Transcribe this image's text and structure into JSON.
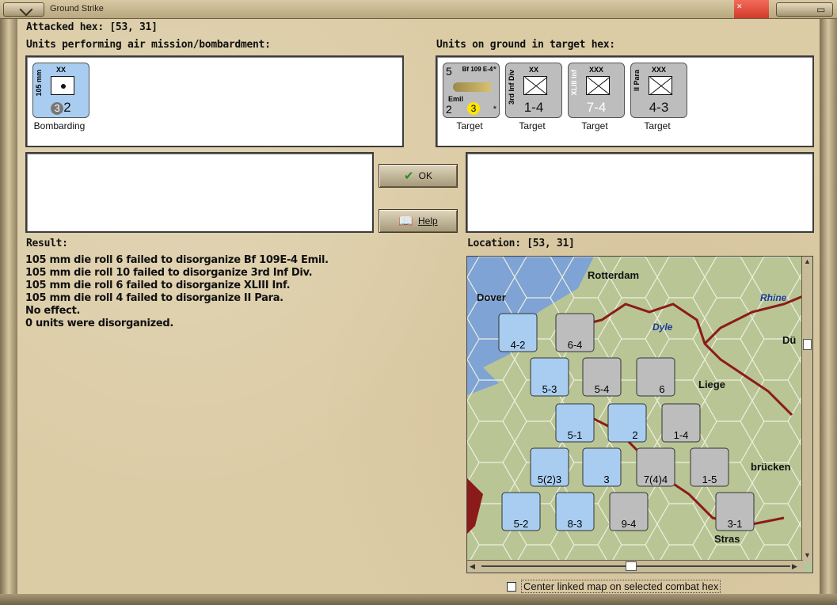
{
  "window": {
    "title": "Ground Strike"
  },
  "attacked_hex": {
    "label": "Attacked hex:",
    "value": "[53, 31]"
  },
  "air_units": {
    "label": "Units performing air mission/bombardment:",
    "items": [
      {
        "top": "XX",
        "side": "105 mm",
        "badge": "3",
        "value": "2",
        "caption": "Bombarding"
      }
    ]
  },
  "ground_units": {
    "label": "Units on ground in target hex:",
    "items": [
      {
        "top": "Bf 109 E-4",
        "side": "",
        "name": "Emil",
        "value": "",
        "strength_left": "5",
        "strength_bottom": "2",
        "badge": "3",
        "caption": "Target",
        "kind": "air"
      },
      {
        "top": "XX",
        "side": "3rd Inf Div",
        "value": "1-4",
        "caption": "Target",
        "kind": "x"
      },
      {
        "top": "XXX",
        "side": "XLIII Inf",
        "value": "7-4",
        "caption": "Target",
        "kind": "x"
      },
      {
        "top": "XXX",
        "side": "II Para",
        "value": "4-3",
        "caption": "Target",
        "kind": "x"
      }
    ]
  },
  "buttons": {
    "ok": "OK",
    "help": "Help"
  },
  "result": {
    "label": "Result:",
    "lines": [
      "105 mm die roll 6 failed to disorganize Bf 109E-4 Emil.",
      "105 mm die roll 10 failed to disorganize 3rd Inf Div.",
      "105 mm die roll 6 failed to disorganize XLIII Inf.",
      "105 mm die roll 4 failed to disorganize II Para.",
      "No effect.",
      "0 units were disorganized."
    ]
  },
  "location": {
    "label": "Location:",
    "value": "[53, 31]"
  },
  "map": {
    "places": [
      "Rotterdam",
      "Dover",
      "Dyle",
      "Liege",
      "Rhine",
      "Dü",
      "brücken",
      "Stras"
    ],
    "counters": [
      {
        "value": "4-2"
      },
      {
        "value": "6-4"
      },
      {
        "value": "5-3"
      },
      {
        "value": "5-4"
      },
      {
        "value": "6"
      },
      {
        "value": "5-1"
      },
      {
        "value": "2"
      },
      {
        "value": "1-4"
      },
      {
        "value": "5(2)3"
      },
      {
        "value": "7(4)4"
      },
      {
        "value": "1-5"
      },
      {
        "value": "3"
      },
      {
        "value": "5-2"
      },
      {
        "value": "8-3"
      },
      {
        "value": "9-4"
      },
      {
        "value": "3-1"
      }
    ]
  },
  "checkbox": {
    "label": "Center linked map on selected combat hex"
  },
  "colors": {
    "panel_bg": "#ffffff",
    "counter_blue": "#a9cdf0",
    "counter_grey": "#bdbdbd",
    "sea": "#7ea3d4",
    "land": "#b8c49a",
    "border_red": "#8b1a1a"
  }
}
